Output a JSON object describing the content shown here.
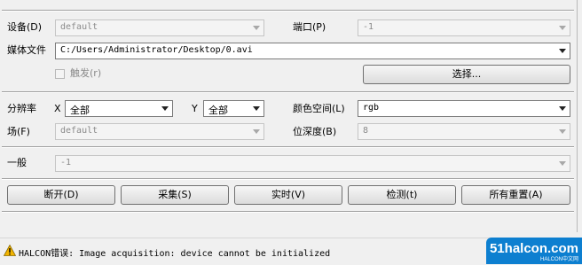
{
  "device_section": {
    "device_label": "设备(D)",
    "device_value": "default",
    "port_label": "端口(P)",
    "port_value": "-1",
    "media_file_label": "媒体文件",
    "media_file_value": "C:/Users/Administrator/Desktop/0.avi",
    "trigger_label": "触发(r)",
    "select_button": "选择..."
  },
  "image_section": {
    "resolution_label": "分辨率",
    "x_label": "X",
    "x_value": "全部",
    "y_label": "Y",
    "y_value": "全部",
    "color_space_label": "颜色空间(L)",
    "color_space_value": "rgb",
    "field_label": "场(F)",
    "field_value": "default",
    "bit_depth_label": "位深度(B)",
    "bit_depth_value": "8"
  },
  "general_section": {
    "general_label": "一般",
    "general_value": "-1"
  },
  "actions": {
    "disconnect": "断开(D)",
    "capture": "采集(S)",
    "live": "实时(V)",
    "detect": "检测(t)",
    "reset_all": "所有重置(A)"
  },
  "status_bar": {
    "message": "HALCON错误: Image acquisition: device cannot be initialized"
  },
  "watermark": {
    "main": "51halcon.com",
    "sub": "HALCON中文网"
  },
  "colors": {
    "background": "#f0f0f0",
    "warning": "#f2b400",
    "watermark": "#0d7fd0"
  }
}
